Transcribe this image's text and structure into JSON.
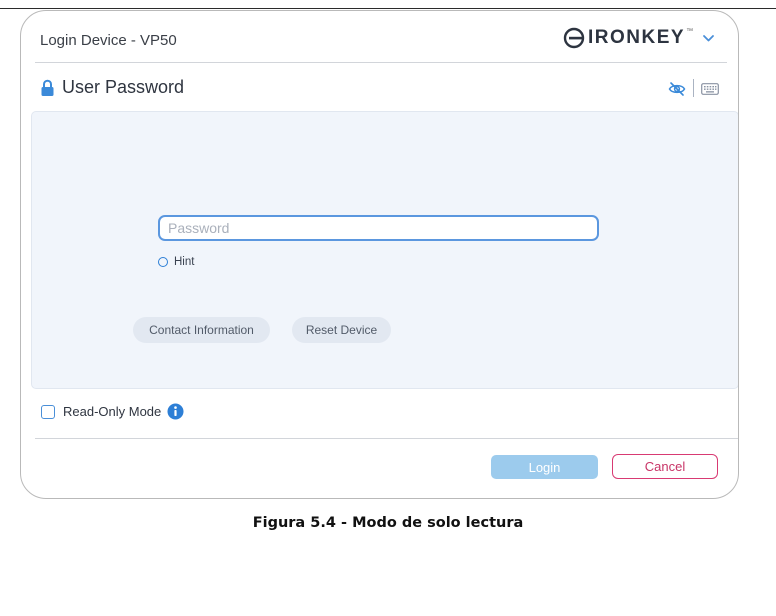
{
  "window": {
    "title": "Login Device - VP50",
    "brand": {
      "name": "IRONKEY",
      "trademark": "™"
    }
  },
  "section": {
    "title": "User Password"
  },
  "icons": {
    "lock": "lock-icon",
    "hide_password": "eye-off-icon",
    "keyboard": "keyboard-icon",
    "info": "info-icon",
    "brand_chevron": "chevron-down-icon"
  },
  "password": {
    "placeholder": "Password",
    "value": ""
  },
  "hint": {
    "label": "Hint"
  },
  "actions": {
    "contact": "Contact Information",
    "reset": "Reset Device"
  },
  "read_only": {
    "label": "Read-Only Mode",
    "checked": false
  },
  "footer": {
    "login": "Login",
    "cancel": "Cancel"
  },
  "caption": "Figura 5.4 - Modo de solo lectura",
  "colors": {
    "accent": "#2d7fd6",
    "login_button": "#9ccbed",
    "cancel_border": "#d83a73",
    "panel": "#f1f5fb"
  }
}
